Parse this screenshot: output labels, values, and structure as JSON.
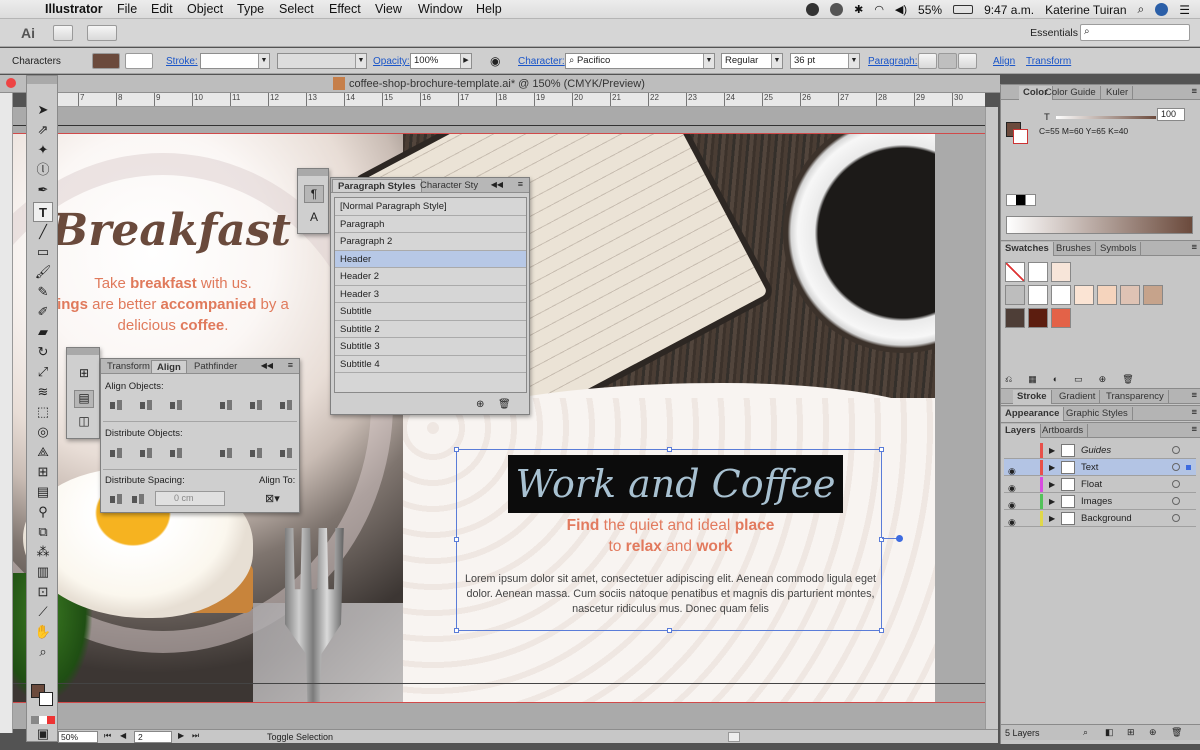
{
  "menubar": {
    "app": "Illustrator",
    "items": [
      "File",
      "Edit",
      "Object",
      "Type",
      "Select",
      "Effect",
      "View",
      "Window",
      "Help"
    ],
    "battery": "55%",
    "time": "9:47 a.m.",
    "user": "Katerine Tuiran"
  },
  "appbar": {
    "logo": "Ai",
    "workspace": "Essentials"
  },
  "control": {
    "type_label": "Characters",
    "stroke_label": "Stroke:",
    "opacity_label": "Opacity:",
    "opacity_value": "100%",
    "character_label": "Character:",
    "font": "Pacifico",
    "style": "Regular",
    "size": "36 pt",
    "paragraph_label": "Paragraph:",
    "align_link": "Align",
    "transform_link": "Transform"
  },
  "document": {
    "tab_title": "coffee-shop-brochure-template.ai* @ 150% (CMYK/Preview)"
  },
  "ruler": {
    "marks": [
      "7",
      "8",
      "9",
      "10",
      "11",
      "12",
      "13",
      "14",
      "15",
      "16",
      "17",
      "18",
      "19",
      "20",
      "21",
      "22",
      "23",
      "24",
      "25",
      "26",
      "27",
      "28",
      "29",
      "30",
      "31"
    ]
  },
  "artwork": {
    "left_title": "Breakfast",
    "left_sub_1a": "Take ",
    "left_sub_1b": "breakfast",
    "left_sub_1c": " with us.",
    "left_sub_2a": "ings",
    "left_sub_2b": " are better ",
    "left_sub_2c": "accompanied",
    "left_sub_2d": " by a",
    "left_sub_3a": "delicious ",
    "left_sub_3b": "coffee",
    "left_sub_3c": ".",
    "banner": "Work and Coffee",
    "tag_1a": "Find",
    "tag_1b": " the quiet and ideal ",
    "tag_1c": "place",
    "tag_2a": "to ",
    "tag_2b": "relax",
    "tag_2c": " and ",
    "tag_2d": "work",
    "lorem": "Lorem ipsum dolor sit amet, consectetuer adipiscing elit. Aenean commodo ligula eget dolor. Aenean massa. Cum sociis natoque penatibus et magnis dis parturient montes, nascetur ridiculus mus. Donec quam felis"
  },
  "paragraph_styles": {
    "tabs": [
      "Paragraph Styles",
      "Character Sty"
    ],
    "items": [
      "[Normal Paragraph Style]",
      "Paragraph",
      "Paragraph 2",
      "Header",
      "Header 2",
      "Header 3",
      "Subtitle",
      "Subtitle 2",
      "Subtitle 3",
      "Subtitle 4"
    ],
    "selected": "Header"
  },
  "align_panel": {
    "tabs": [
      "Transform",
      "Align",
      "Pathfinder"
    ],
    "align_objects": "Align Objects:",
    "distribute_objects": "Distribute Objects:",
    "distribute_spacing": "Distribute Spacing:",
    "align_to": "Align To:",
    "spacing_value": "0 cm"
  },
  "right_panel": {
    "color_tabs": [
      "Color",
      "Color Guide",
      "Kuler"
    ],
    "tint_label": "T",
    "tint_value": "100",
    "cmyk": "C=55 M=60 Y=65 K=40",
    "swatch_tabs": [
      "Swatches",
      "Brushes",
      "Symbols"
    ],
    "stroke_tabs": [
      "Stroke",
      "Gradient",
      "Transparency"
    ],
    "appearance_tabs": [
      "Appearance",
      "Graphic Styles"
    ],
    "layer_tabs": [
      "Layers",
      "Artboards"
    ],
    "layers": [
      {
        "name": "Guides",
        "color": "#e8504a"
      },
      {
        "name": "Text",
        "color": "#e8504a"
      },
      {
        "name": "Float",
        "color": "#d84be0"
      },
      {
        "name": "Images",
        "color": "#53c25a"
      },
      {
        "name": "Background",
        "color": "#e0d84a"
      }
    ],
    "layer_count": "5 Layers"
  },
  "status": {
    "zoom": "50%",
    "page": "2",
    "mode": "Toggle Selection"
  },
  "colors": {
    "accent": "#e07a5c",
    "brand_brown": "#6a4a3c",
    "selection": "#5a7cd8"
  }
}
